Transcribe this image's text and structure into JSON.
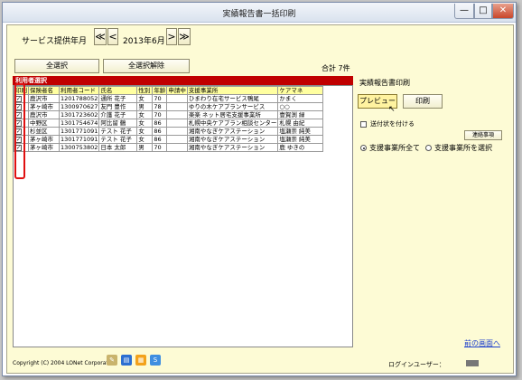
{
  "window": {
    "title": "実績報告書一括印刷",
    "minimize": "—",
    "maximize": "□",
    "close": "✕"
  },
  "header": {
    "service_label": "サービス提供年月",
    "nav_first": "≪",
    "nav_prev": "<",
    "nav_next": ">",
    "nav_last": "≫",
    "year": "2013年",
    "month": "6月"
  },
  "toolbar": {
    "select_all": "全選択",
    "deselect_all": "全選択解除",
    "total": "合計 7件"
  },
  "grid": {
    "panel_title": "利用者選択",
    "columns": [
      "印刷",
      "保険者名",
      "利用者コード",
      "氏名",
      "性別",
      "年齢",
      "申請中",
      "支援事業所",
      "ケアマネ"
    ],
    "rows": [
      {
        "checked": "✓",
        "insurer": "鹿沢市",
        "code": "1201788052",
        "name": "通所 花子",
        "sex": "女",
        "age": "70",
        "pending": "",
        "office": "ひまわり在宅サービス鴨尾",
        "caremgr": "かまく"
      },
      {
        "checked": "✓",
        "insurer": "茅ヶ崎市",
        "code": "1300970627",
        "name": "友門 豊作",
        "sex": "男",
        "age": "78",
        "pending": "",
        "office": "ゆりの木ケアプランサービス",
        "caremgr": "○○"
      },
      {
        "checked": "✓",
        "insurer": "鹿沢市",
        "code": "1301723602",
        "name": "介護 花子",
        "sex": "女",
        "age": "70",
        "pending": "",
        "office": "楽楽 ネット居宅支援事業所",
        "caremgr": "壹賀渕 緑"
      },
      {
        "checked": "✓",
        "insurer": "中野区",
        "code": "1301754674",
        "name": "阿比留 鶴",
        "sex": "女",
        "age": "86",
        "pending": "",
        "office": "札幌中央ケアプラン相談センター",
        "caremgr": "札幌 由紀"
      },
      {
        "checked": "✓",
        "insurer": "杉並区",
        "code": "1301771091",
        "name": "テスト 花子",
        "sex": "女",
        "age": "86",
        "pending": "",
        "office": "湘南やなぎケアステーション",
        "caremgr": "塩瀬崇 純美"
      },
      {
        "checked": "✓",
        "insurer": "茅ヶ崎市",
        "code": "1301771091",
        "name": "テスト 花子",
        "sex": "女",
        "age": "86",
        "pending": "",
        "office": "湘南やなぎケアステーション",
        "caremgr": "塩瀬崇 純美"
      },
      {
        "checked": "✓",
        "insurer": "茅ヶ崎市",
        "code": "1300753802",
        "name": "日本 太郎",
        "sex": "男",
        "age": "70",
        "pending": "",
        "office": "湘南やなぎケアステーション",
        "caremgr": "鹿 ゆきの"
      }
    ]
  },
  "print_panel": {
    "title": "実績報告書印刷",
    "preview": "プレビュー",
    "print": "印刷",
    "cover_checkbox": "送付状を付ける",
    "contact_button": "連絡事項",
    "radio_all": "支援事業所全て",
    "radio_select": "支援事業所を選択"
  },
  "footer": {
    "back_link": "前の画面へ",
    "copyright": "Copyright (C) 2004 LONet Corporation",
    "login_label": "ログインユーザー："
  },
  "colors": {
    "background": "#fdfbd5",
    "header_row": "#ffffa0",
    "panel_header": "#c00000",
    "link": "#1a3ccc",
    "highlight": "#e01010"
  }
}
